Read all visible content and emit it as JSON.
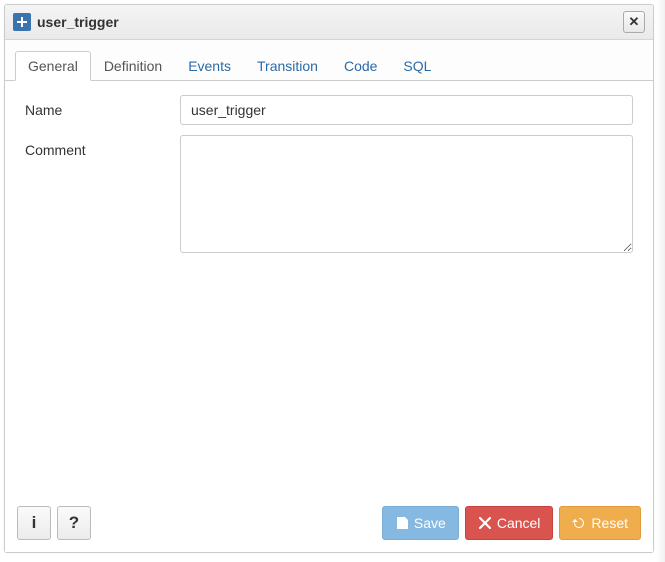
{
  "dialog": {
    "title": "user_trigger"
  },
  "tabs": [
    {
      "label": "General",
      "state": "active"
    },
    {
      "label": "Definition",
      "state": "secondary-active"
    },
    {
      "label": "Events",
      "state": ""
    },
    {
      "label": "Transition",
      "state": ""
    },
    {
      "label": "Code",
      "state": ""
    },
    {
      "label": "SQL",
      "state": ""
    }
  ],
  "form": {
    "name_label": "Name",
    "name_value": "user_trigger",
    "comment_label": "Comment",
    "comment_value": ""
  },
  "footer": {
    "save_label": "Save",
    "cancel_label": "Cancel",
    "reset_label": "Reset"
  }
}
